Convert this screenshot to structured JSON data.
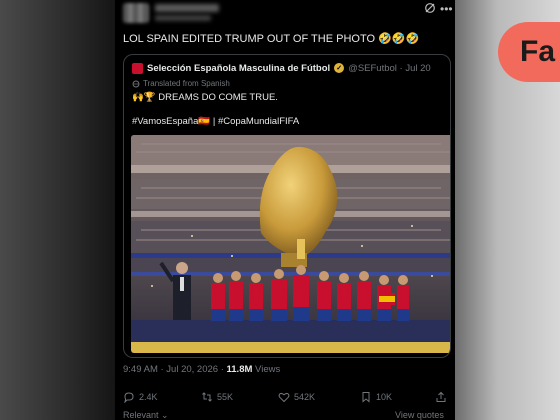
{
  "tweet": {
    "text": "LOL SPAIN EDITED TRUMP OUT OF THE PHOTO",
    "emojis": "🤣🤣🤣"
  },
  "quoted": {
    "name": "Selección Española Masculina de Fútbol",
    "handle_date": "@SEFutbol · Jul 20",
    "translated": "Translated from Spanish",
    "text": "🙌🏆 DREAMS DO COME TRUE.",
    "hashtags": "#VamosEspaña🇪🇸 | #CopaMundialFIFA"
  },
  "meta": {
    "time": "9:49 AM · Jul 20, 2026 · ",
    "views_count": "11.8M",
    "views_label": " Views"
  },
  "actions": {
    "replies": "2.4K",
    "reposts": "55K",
    "likes": "542K",
    "bookmarks": "10K"
  },
  "footer": {
    "relevant": "Relevant",
    "view_quotes": "View quotes"
  },
  "brand": {
    "logo_text": "Fa",
    "accent": "#f26a5c"
  },
  "icons": [
    "grok-icon",
    "more-icon",
    "translate-icon",
    "reply-icon",
    "repost-icon",
    "like-icon",
    "bookmark-icon",
    "share-icon"
  ]
}
